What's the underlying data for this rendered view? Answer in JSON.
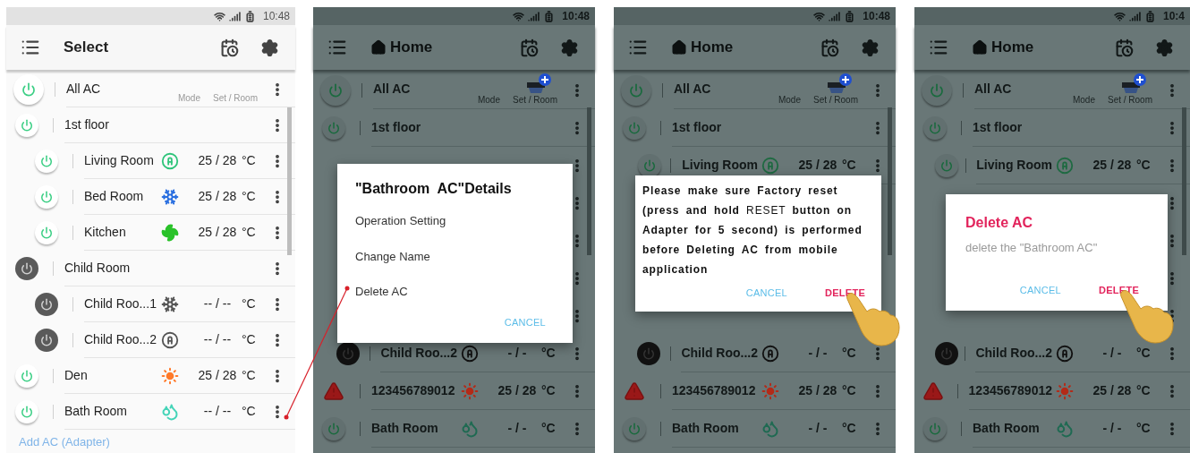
{
  "phones": [
    {
      "status": {
        "time": "10:48"
      },
      "title": "Select",
      "dimmed": false,
      "rows": [
        {
          "kind": "all",
          "name": "All AC",
          "power": {
            "kind": "on"
          },
          "labels": [
            "Mode",
            "Set / Room"
          ]
        },
        {
          "kind": "row",
          "name": "1st floor",
          "power": {
            "kind": "on"
          },
          "children": [
            {
              "kind": "row",
              "name": "Living Room",
              "power": {
                "kind": "on"
              },
              "mode": {
                "kind": "auto"
              },
              "temp": "25 / 28",
              "unit": "°C"
            },
            {
              "kind": "row",
              "name": "Bed Room",
              "power": {
                "kind": "on"
              },
              "mode": {
                "kind": "cool"
              },
              "temp": "25 / 28",
              "unit": "°C"
            },
            {
              "kind": "row",
              "name": "Kitchen",
              "power": {
                "kind": "on"
              },
              "mode": {
                "kind": "fan"
              },
              "temp": "25 / 28",
              "unit": "°C"
            }
          ]
        },
        {
          "kind": "row",
          "name": "Child Room",
          "power": {
            "kind": "off"
          },
          "children": [
            {
              "kind": "row",
              "name": "Child Roo...1",
              "power": {
                "kind": "off"
              },
              "mode": {
                "kind": "cool"
              },
              "temp": "-- / --",
              "unit": "°C"
            },
            {
              "kind": "row",
              "name": "Child Roo...2",
              "power": {
                "kind": "off"
              },
              "mode": {
                "kind": "auto"
              },
              "temp": "-- / --",
              "unit": "°C"
            }
          ]
        },
        {
          "kind": "row",
          "name": "Den",
          "power": {
            "kind": "on"
          },
          "mode": {
            "kind": "heat"
          },
          "temp": "25 / 28",
          "unit": "°C"
        },
        {
          "kind": "row",
          "name": "Bath Room",
          "power": {
            "kind": "on"
          },
          "mode": {
            "kind": "dry"
          },
          "temp": "-- / --",
          "unit": "°C"
        }
      ],
      "add_link": "Add AC (Adapter)"
    },
    {
      "status": {
        "time": "10:48"
      },
      "title": "Home",
      "home_icon": true,
      "dimmed": true,
      "rows": [
        {
          "kind": "all",
          "name": "All AC",
          "power": {
            "kind": "on"
          },
          "labels": [
            "Mode",
            "Set / Room"
          ],
          "add_icon": true
        },
        {
          "kind": "row",
          "name": "1st floor",
          "power": {
            "kind": "on"
          },
          "children": [
            {
              "kind": "covered"
            },
            {
              "kind": "covered"
            },
            {
              "kind": "covered"
            }
          ]
        },
        {
          "kind": "covered",
          "children": [
            {
              "kind": "covered"
            },
            {
              "kind": "row",
              "name": "Child Roo...2",
              "power": {
                "kind": "off"
              },
              "mode": {
                "kind": "auto"
              },
              "temp": "- / -",
              "unit": "°C"
            }
          ]
        },
        {
          "kind": "row",
          "name": "123456789012",
          "power": {
            "kind": "alert"
          },
          "mode": {
            "kind": "heat"
          },
          "temp": "25 / 28",
          "unit": "°C"
        },
        {
          "kind": "row",
          "name": "Bath Room",
          "power": {
            "kind": "on"
          },
          "mode": {
            "kind": "dry"
          },
          "temp": "- / -",
          "unit": "°C"
        }
      ],
      "dialog": {
        "kind": "menu",
        "title": "\"Bathroom  AC\"Details",
        "items": [
          "Operation Setting",
          "Change Name",
          "Delete AC"
        ],
        "buttons": [
          {
            "label": "CANCEL",
            "kind": "cancel"
          }
        ]
      }
    },
    {
      "status": {
        "time": "10:48"
      },
      "title": "Home",
      "home_icon": true,
      "dimmed": true,
      "rows": [
        {
          "kind": "all",
          "name": "All AC",
          "power": {
            "kind": "on"
          },
          "labels": [
            "Mode",
            "Set / Room"
          ],
          "add_icon": true
        },
        {
          "kind": "row",
          "name": "1st floor",
          "power": {
            "kind": "on"
          },
          "children": [
            {
              "kind": "row",
              "name": "Living Room",
              "power": {
                "kind": "on"
              },
              "mode": {
                "kind": "auto"
              },
              "temp": "25 / 28",
              "unit": "°C"
            },
            {
              "kind": "covered"
            },
            {
              "kind": "covered"
            }
          ]
        },
        {
          "kind": "covered",
          "children": [
            {
              "kind": "covered"
            },
            {
              "kind": "row",
              "name": "Child Roo...2",
              "power": {
                "kind": "off"
              },
              "mode": {
                "kind": "auto"
              },
              "temp": "- / -",
              "unit": "°C"
            }
          ]
        },
        {
          "kind": "row",
          "name": "123456789012",
          "power": {
            "kind": "alert"
          },
          "mode": {
            "kind": "heat"
          },
          "temp": "25 / 28",
          "unit": "°C"
        },
        {
          "kind": "row",
          "name": "Bath Room",
          "power": {
            "kind": "on"
          },
          "mode": {
            "kind": "dry"
          },
          "temp": "- / -",
          "unit": "°C"
        }
      ],
      "dialog": {
        "kind": "warning",
        "message": "**Please make sure Factory reset (press and hold** RESET **button on Adapter for 5 second) is performed before Deleting AC from mobile application**",
        "buttons": [
          {
            "label": "CANCEL",
            "kind": "cancel"
          },
          {
            "label": "DELETE",
            "kind": "delete",
            "pointed": true
          }
        ]
      }
    },
    {
      "status": {
        "time": "10:4"
      },
      "title": "Home",
      "home_icon": true,
      "dimmed": true,
      "rows": [
        {
          "kind": "all",
          "name": "All AC",
          "power": {
            "kind": "on"
          },
          "labels": [
            "Mode",
            "Set / Room"
          ],
          "add_icon": true
        },
        {
          "kind": "row",
          "name": "1st floor",
          "power": {
            "kind": "on"
          },
          "children": [
            {
              "kind": "row",
              "name": "Living Room",
              "power": {
                "kind": "on"
              },
              "mode": {
                "kind": "auto"
              },
              "temp": "25 / 28",
              "unit": "°C"
            },
            {
              "kind": "covered"
            },
            {
              "kind": "covered"
            }
          ]
        },
        {
          "kind": "covered",
          "children": [
            {
              "kind": "covered"
            },
            {
              "kind": "row",
              "name": "Child Roo...2",
              "power": {
                "kind": "off"
              },
              "mode": {
                "kind": "auto"
              },
              "temp": "- / -",
              "unit": "°C"
            }
          ]
        },
        {
          "kind": "row",
          "name": "123456789012",
          "power": {
            "kind": "alert"
          },
          "mode": {
            "kind": "heat"
          },
          "temp": "25 / 28",
          "unit": "°C"
        },
        {
          "kind": "row",
          "name": "Bath Room",
          "power": {
            "kind": "on"
          },
          "mode": {
            "kind": "dry"
          },
          "temp": "- / -",
          "unit": "°C"
        }
      ],
      "dialog": {
        "kind": "confirm",
        "title": "Delete AC",
        "message": "delete the \"Bathroom AC\"",
        "buttons": [
          {
            "label": "CANCEL",
            "kind": "cancel"
          },
          {
            "label": "DELETE",
            "kind": "delete",
            "pointed": true
          }
        ]
      }
    }
  ]
}
